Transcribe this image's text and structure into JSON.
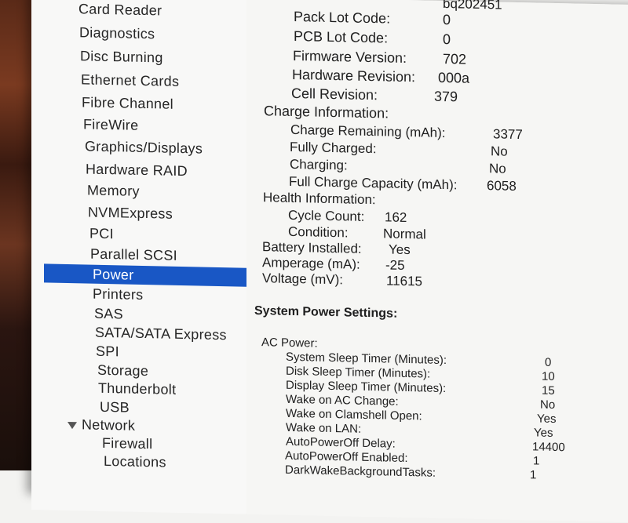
{
  "sidebar": {
    "items": [
      {
        "label": "Card Reader"
      },
      {
        "label": "Diagnostics"
      },
      {
        "label": "Disc Burning"
      },
      {
        "label": "Ethernet Cards"
      },
      {
        "label": "Fibre Channel"
      },
      {
        "label": "FireWire"
      },
      {
        "label": "Graphics/Displays"
      },
      {
        "label": "Hardware RAID"
      },
      {
        "label": "Memory"
      },
      {
        "label": "NVMExpress"
      },
      {
        "label": "PCI"
      },
      {
        "label": "Parallel SCSI"
      },
      {
        "label": "Power",
        "selected": true
      },
      {
        "label": "Printers"
      },
      {
        "label": "SAS"
      },
      {
        "label": "SATA/SATA Express"
      },
      {
        "label": "SPI"
      },
      {
        "label": "Storage"
      },
      {
        "label": "Thunderbolt"
      },
      {
        "label": "USB"
      }
    ],
    "network": {
      "label": "Network",
      "children": [
        {
          "label": "Firewall"
        },
        {
          "label": "Locations"
        }
      ]
    }
  },
  "detail": {
    "top_partial_value": "bq202451",
    "model_info": [
      {
        "label": "Pack Lot Code:",
        "value": "0"
      },
      {
        "label": "PCB Lot Code:",
        "value": "0"
      },
      {
        "label": "Firmware Version:",
        "value": "702"
      },
      {
        "label": "Hardware Revision:",
        "value": "000a"
      },
      {
        "label": "Cell Revision:",
        "value": "379"
      }
    ],
    "charge_heading": "Charge Information:",
    "charge": [
      {
        "label": "Charge Remaining (mAh):",
        "value": "3377"
      },
      {
        "label": "Fully Charged:",
        "value": "No"
      },
      {
        "label": "Charging:",
        "value": "No"
      },
      {
        "label": "Full Charge Capacity (mAh):",
        "value": "6058"
      }
    ],
    "health_heading": "Health Information:",
    "health": [
      {
        "label": "Cycle Count:",
        "value": "162"
      },
      {
        "label": "Condition:",
        "value": "Normal"
      }
    ],
    "battery": [
      {
        "label": "Battery Installed:",
        "value": "Yes"
      },
      {
        "label": "Amperage (mA):",
        "value": "-25"
      },
      {
        "label": "Voltage (mV):",
        "value": "11615"
      }
    ],
    "power_settings_heading": "System Power Settings:",
    "ac_power_heading": "AC Power:",
    "ac_power": [
      {
        "label": "System Sleep Timer (Minutes):",
        "value": "0"
      },
      {
        "label": "Disk Sleep Timer (Minutes):",
        "value": "10"
      },
      {
        "label": "Display Sleep Timer (Minutes):",
        "value": "15"
      },
      {
        "label": "Wake on AC Change:",
        "value": "No"
      },
      {
        "label": "Wake on Clamshell Open:",
        "value": "Yes"
      },
      {
        "label": "Wake on LAN:",
        "value": "Yes"
      },
      {
        "label": "AutoPowerOff Delay:",
        "value": "14400"
      },
      {
        "label": "AutoPowerOff Enabled:",
        "value": "1"
      },
      {
        "label": "DarkWakeBackgroundTasks:",
        "value": "1"
      }
    ]
  }
}
